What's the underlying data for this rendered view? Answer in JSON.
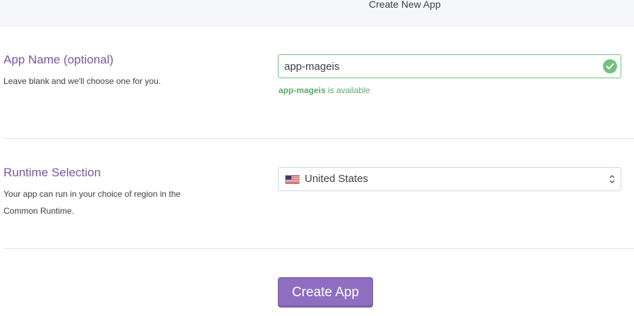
{
  "header": {
    "title": "Create New App"
  },
  "app_name": {
    "title": "App Name (optional)",
    "description": "Leave blank and we'll choose one for you.",
    "value": "app-mageis",
    "status_name": "app-mageis",
    "status_text": " is available"
  },
  "runtime": {
    "title": "Runtime Selection",
    "description": "Your app can run in your choice of region in the Common Runtime.",
    "selected_region": "United States",
    "selected_flag": "us-flag-icon"
  },
  "actions": {
    "create_label": "Create App"
  },
  "colors": {
    "accent": "#79589f",
    "button": "#8e6ec0",
    "success": "#74c080"
  }
}
